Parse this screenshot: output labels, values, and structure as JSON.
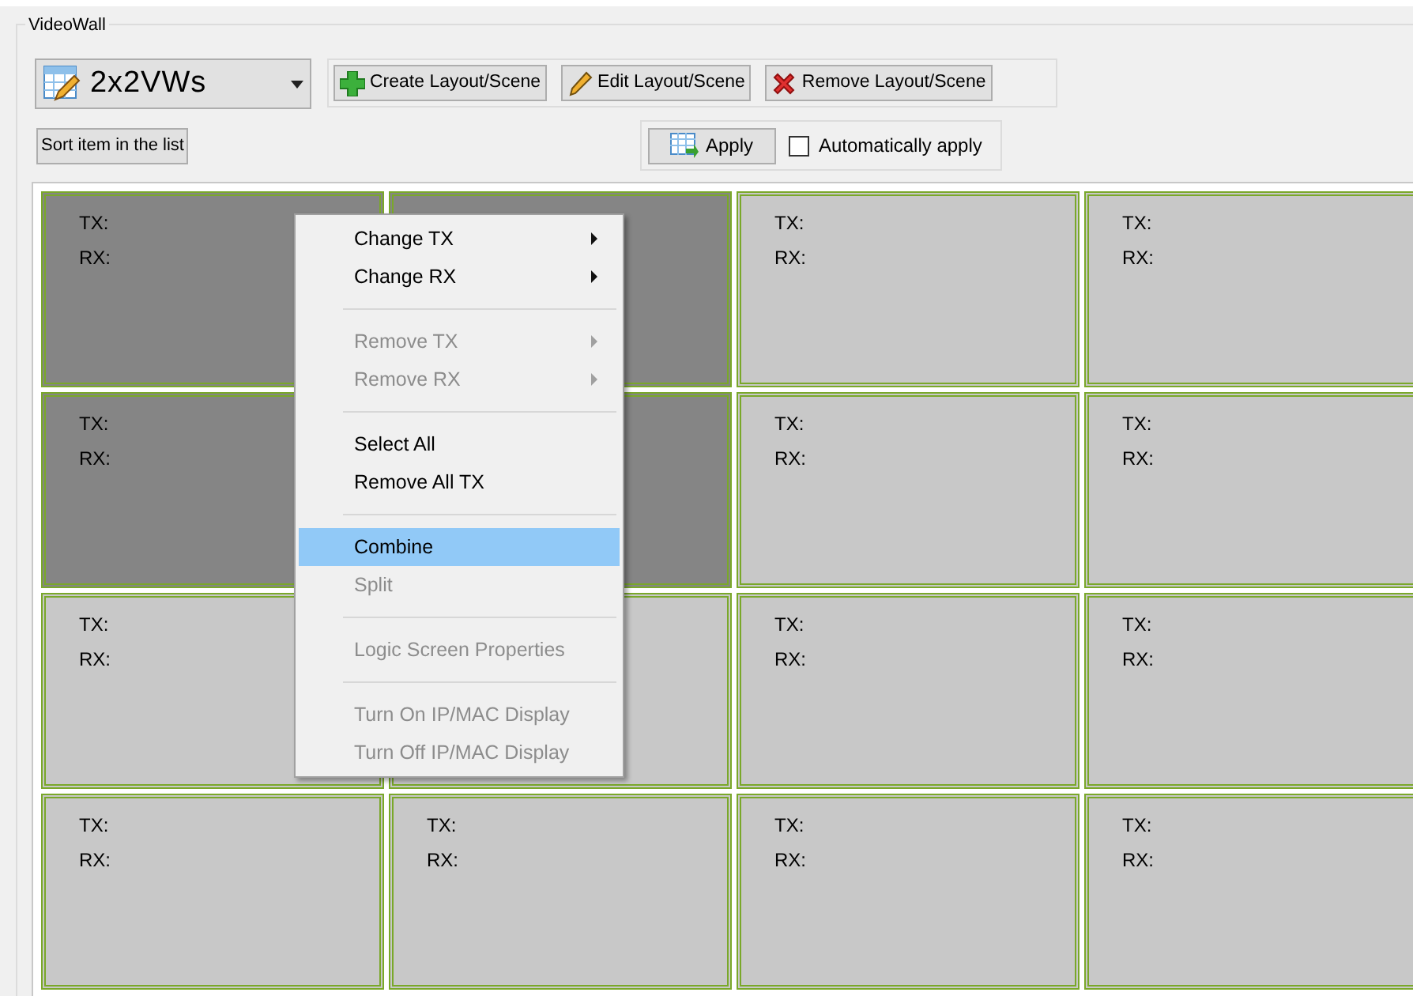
{
  "group_title": "VideoWall",
  "layout_select": {
    "value": "2x2VWs"
  },
  "toolbar": [
    {
      "kind": "create",
      "label": "Create Layout/Scene"
    },
    {
      "kind": "edit",
      "label": "Edit Layout/Scene"
    },
    {
      "kind": "remove",
      "label": "Remove Layout/Scene"
    }
  ],
  "sort_button": "Sort item in the list",
  "apply_button": "Apply",
  "auto_apply": {
    "label": "Automatically apply",
    "checked": false
  },
  "cells": [
    {
      "selected": true,
      "tx": "TX:",
      "rx": "RX:"
    },
    {
      "selected": true
    },
    {
      "selected": false,
      "tx": "TX:",
      "rx": "RX:"
    },
    {
      "selected": false,
      "tx": "TX:",
      "rx": "RX:"
    },
    {
      "selected": true,
      "tx": "TX:",
      "rx": "RX:"
    },
    {
      "selected": true
    },
    {
      "selected": false,
      "tx": "TX:",
      "rx": "RX:"
    },
    {
      "selected": false,
      "tx": "TX:",
      "rx": "RX:"
    },
    {
      "selected": false,
      "tx": "TX:",
      "rx": "RX:"
    },
    {
      "selected": false
    },
    {
      "selected": false,
      "tx": "TX:",
      "rx": "RX:"
    },
    {
      "selected": false,
      "tx": "TX:",
      "rx": "RX:"
    },
    {
      "selected": false,
      "tx": "TX:",
      "rx": "RX:"
    },
    {
      "selected": false,
      "tx": "TX:",
      "rx": "RX:"
    },
    {
      "selected": false,
      "tx": "TX:",
      "rx": "RX:"
    },
    {
      "selected": false,
      "tx": "TX:",
      "rx": "RX:"
    }
  ],
  "context_menu": [
    {
      "kind": "item",
      "label": "Change TX",
      "disabled": false,
      "submenu": true,
      "selected": false
    },
    {
      "kind": "item",
      "label": "Change RX",
      "disabled": false,
      "submenu": true,
      "selected": false
    },
    {
      "kind": "separator"
    },
    {
      "kind": "item",
      "label": "Remove TX",
      "disabled": true,
      "submenu": true,
      "selected": false
    },
    {
      "kind": "item",
      "label": "Remove RX",
      "disabled": true,
      "submenu": true,
      "selected": false
    },
    {
      "kind": "separator"
    },
    {
      "kind": "item",
      "label": "Select All",
      "disabled": false,
      "submenu": false,
      "selected": false
    },
    {
      "kind": "item",
      "label": "Remove All TX",
      "disabled": false,
      "submenu": false,
      "selected": false
    },
    {
      "kind": "separator"
    },
    {
      "kind": "item",
      "label": "Combine",
      "disabled": false,
      "submenu": false,
      "selected": true
    },
    {
      "kind": "item",
      "label": "Split",
      "disabled": true,
      "submenu": false,
      "selected": false
    },
    {
      "kind": "separator"
    },
    {
      "kind": "item",
      "label": "Logic Screen Properties",
      "disabled": true,
      "submenu": false,
      "selected": false
    },
    {
      "kind": "separator"
    },
    {
      "kind": "item",
      "label": "Turn On IP/MAC Display",
      "disabled": true,
      "submenu": false,
      "selected": false
    },
    {
      "kind": "item",
      "label": "Turn Off IP/MAC Display",
      "disabled": true,
      "submenu": false,
      "selected": false
    }
  ]
}
